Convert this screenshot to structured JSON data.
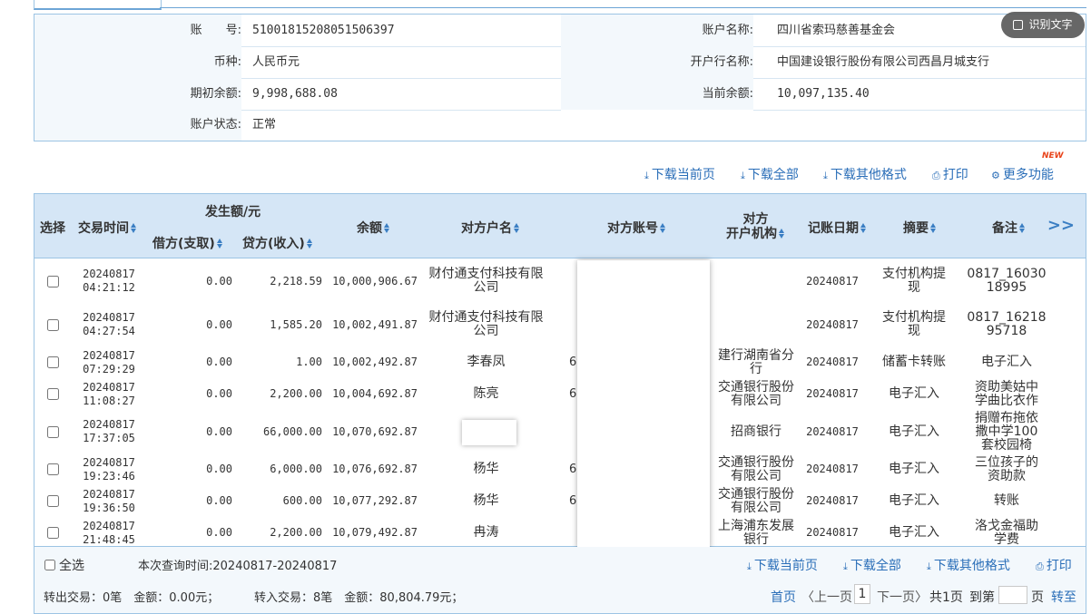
{
  "account_info": {
    "account_no_label": "账　　号:",
    "account_no": "51001815208051506397",
    "account_name_label": "账户名称:",
    "account_name": "四川省索玛慈善基金会",
    "currency_label": "币种:",
    "currency": "人民币元",
    "bank_label": "开户行名称:",
    "bank": "中国建设银行股份有限公司西昌月城支行",
    "opening_balance_label": "期初余额:",
    "opening_balance": "9,998,688.08",
    "current_balance_label": "当前余额:",
    "current_balance": "10,097,135.40",
    "status_label": "账户状态:",
    "status": "正常"
  },
  "ocr_button": {
    "label": "识别文字",
    "icon": "text-recognition-icon"
  },
  "toolbar": {
    "badge": "NEW",
    "download_page": "下载当前页",
    "download_all": "下载全部",
    "download_other": "下载其他格式",
    "print": "打印",
    "more": "更多功能"
  },
  "table": {
    "headers": {
      "select": "选择",
      "time": "交易时间",
      "amount_group": "发生额/元",
      "debit": "借方(支取)",
      "credit": "贷方(收入)",
      "balance": "余额",
      "counterparty_name": "对方户名",
      "counterparty_account": "对方账号",
      "counterparty_org_line1": "对方",
      "counterparty_org_line2": "开户机构",
      "posting_date": "记账日期",
      "summary": "摘要",
      "note": "备注",
      "more": ">>"
    },
    "rows": [
      {
        "time_date": "20240817",
        "time_clock": "04:21:12",
        "debit": "0.00",
        "credit": "2,218.59",
        "balance": "10,000,906.67",
        "name": "财付通支付科技有限公司",
        "acct": "",
        "org": "",
        "date": "20240817",
        "summary": "支付机构提现",
        "note": "0817_16030 18995"
      },
      {
        "time_date": "20240817",
        "time_clock": "04:27:54",
        "debit": "0.00",
        "credit": "1,585.20",
        "balance": "10,002,491.87",
        "name": "财付通支付科技有限公司",
        "acct": "",
        "org": "",
        "date": "20240817",
        "summary": "支付机构提现",
        "note": "0817_16218 95718"
      },
      {
        "time_date": "20240817",
        "time_clock": "07:29:29",
        "debit": "0.00",
        "credit": "1.00",
        "balance": "10,002,492.87",
        "name": "李春凤",
        "acct": "6",
        "org": "建行湖南省分行",
        "date": "20240817",
        "summary": "储蓄卡转账",
        "note": "电子汇入"
      },
      {
        "time_date": "20240817",
        "time_clock": "11:08:27",
        "debit": "0.00",
        "credit": "2,200.00",
        "balance": "10,004,692.87",
        "name": "陈亮",
        "acct": "6",
        "org": "交通银行股份有限公司",
        "date": "20240817",
        "summary": "电子汇入",
        "note": "资助美姑中学曲比衣作"
      },
      {
        "time_date": "20240817",
        "time_clock": "17:37:05",
        "debit": "0.00",
        "credit": "66,000.00",
        "balance": "10,070,692.87",
        "name": "",
        "acct": "",
        "org": "招商银行",
        "date": "20240817",
        "summary": "电子汇入",
        "note": "捐赠布拖依撒中学100套校园椅"
      },
      {
        "time_date": "20240817",
        "time_clock": "19:23:46",
        "debit": "0.00",
        "credit": "6,000.00",
        "balance": "10,076,692.87",
        "name": "杨华",
        "acct": "6",
        "org": "交通银行股份有限公司",
        "date": "20240817",
        "summary": "电子汇入",
        "note": "三位孩子的资助款"
      },
      {
        "time_date": "20240817",
        "time_clock": "19:36:50",
        "debit": "0.00",
        "credit": "600.00",
        "balance": "10,077,292.87",
        "name": "杨华",
        "acct": "6",
        "org": "交通银行股份有限公司",
        "date": "20240817",
        "summary": "电子汇入",
        "note": "转账"
      },
      {
        "time_date": "20240817",
        "time_clock": "21:48:45",
        "debit": "0.00",
        "credit": "2,200.00",
        "balance": "10,079,492.87",
        "name": "冉涛",
        "acct": "",
        "org": "上海浦东发展银行",
        "date": "20240817",
        "summary": "电子汇入",
        "note": "洛戈金福助学费"
      }
    ]
  },
  "footer": {
    "select_all": "全选",
    "query_time": "本次查询时间:20240817-20240817",
    "download_page": "下载当前页",
    "download_all": "下载全部",
    "download_other": "下载其他格式",
    "print": "打印",
    "out_summary": "转出交易：0笔　金额：0.00元；",
    "in_summary": "转入交易：8笔　金额：80,804.79元；",
    "first_page": "首页",
    "prev_page": "〈上一页",
    "current_page": "1",
    "next_page": "下一页〉",
    "total_pages": "共1页",
    "goto_label": "到第",
    "page_unit": "页",
    "goto_button": "转至"
  }
}
